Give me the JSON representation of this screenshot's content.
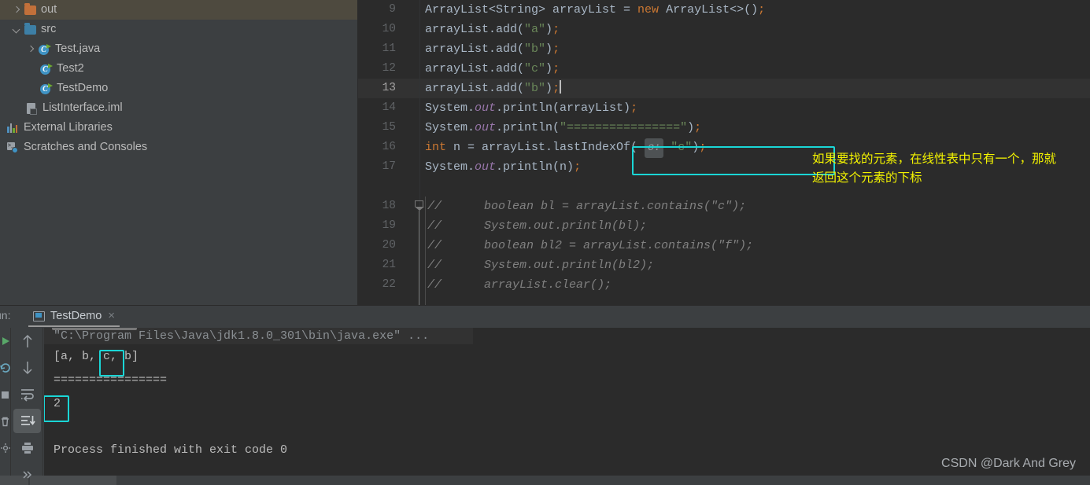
{
  "sidebar": {
    "items": [
      {
        "label": "out",
        "icon": "folder-orange-icon",
        "arrow": "chevron-right-icon",
        "indent": 14,
        "selected": true
      },
      {
        "label": "src",
        "icon": "folder-blue-icon",
        "arrow": "chevron-down-icon",
        "indent": 14,
        "selected": false
      },
      {
        "label": "Test.java",
        "icon": "java-class-icon",
        "arrow": "chevron-right-icon",
        "indent": 32,
        "selected": false
      },
      {
        "label": "Test2",
        "icon": "java-class-icon",
        "arrow": "none",
        "indent": 50,
        "selected": false
      },
      {
        "label": "TestDemo",
        "icon": "java-class-icon",
        "arrow": "none",
        "indent": 50,
        "selected": false
      },
      {
        "label": "ListInterface.iml",
        "icon": "iml-file-icon",
        "arrow": "none",
        "indent": 32,
        "selected": false
      },
      {
        "label": "External Libraries",
        "icon": "libraries-icon",
        "arrow": "none",
        "indent": 8,
        "selected": false
      },
      {
        "label": "Scratches and Consoles",
        "icon": "scratches-icon",
        "arrow": "none",
        "indent": 8,
        "selected": false
      }
    ]
  },
  "editor": {
    "lines": [
      {
        "num": "9",
        "current": false,
        "comment": ""
      },
      {
        "num": "10",
        "current": false,
        "comment": ""
      },
      {
        "num": "11",
        "current": false,
        "comment": ""
      },
      {
        "num": "12",
        "current": false,
        "comment": ""
      },
      {
        "num": "13",
        "current": true,
        "comment": ""
      },
      {
        "num": "14",
        "current": false,
        "comment": ""
      },
      {
        "num": "15",
        "current": false,
        "comment": ""
      },
      {
        "num": "16",
        "current": false,
        "comment": ""
      },
      {
        "num": "17",
        "current": false,
        "comment": ""
      },
      {
        "num": "18",
        "current": false,
        "comment": "//"
      },
      {
        "num": "19",
        "current": false,
        "comment": "//"
      },
      {
        "num": "20",
        "current": false,
        "comment": "//"
      },
      {
        "num": "21",
        "current": false,
        "comment": "//"
      },
      {
        "num": "22",
        "current": false,
        "comment": "//"
      }
    ],
    "code": {
      "l9_a": "ArrayList<String> arrayList = ",
      "l9_new": "new",
      "l9_b": " ArrayList<>()",
      "l9_semi": ";",
      "l10_a": "arrayList.add(",
      "l10_s": "\"a\"",
      "l10_b": ")",
      "l10_semi": ";",
      "l11_a": "arrayList.add(",
      "l11_s": "\"b\"",
      "l11_b": ")",
      "l11_semi": ";",
      "l12_a": "arrayList.add(",
      "l12_s": "\"c\"",
      "l12_b": ")",
      "l12_semi": ";",
      "l13_a": "arrayList.add(",
      "l13_s": "\"b\"",
      "l13_b": ")",
      "l13_semi": ";",
      "l14_sys": "System.",
      "l14_out": "out",
      "l14_rest": ".println(arrayList)",
      "l14_semi": ";",
      "l15_sys": "System.",
      "l15_out": "out",
      "l15_a": ".println(",
      "l15_s": "\"================\"",
      "l15_b": ")",
      "l15_semi": ";",
      "l16_int": "int",
      "l16_a": " n = arrayList.lastIndexOf( ",
      "l16_hint": "o:",
      "l16_s": "\"c\"",
      "l16_b": ")",
      "l16_semi": ";",
      "l17_sys": "System.",
      "l17_out": "out",
      "l17_rest": ".println(n)",
      "l17_semi": ";",
      "l18": "boolean bl = arrayList.contains(\"c\");",
      "l19": "System.out.println(bl);",
      "l20": "boolean bl2 = arrayList.contains(\"f\");",
      "l21": "System.out.println(bl2);",
      "l22": "arrayList.clear();"
    },
    "annotation_line1": "如果要找的元素，在线性表中只有一个，那就",
    "annotation_line2": "返回这个元素的下标"
  },
  "run_panel": {
    "label": "un:",
    "tab_name": "TestDemo",
    "tab_close": "×",
    "toolbar": [
      {
        "name": "scroll-up-button",
        "icon": "arrow-up-icon",
        "active": false
      },
      {
        "name": "scroll-down-button",
        "icon": "arrow-down-icon",
        "active": false
      },
      {
        "name": "soft-wrap-button",
        "icon": "soft-wrap-icon",
        "active": false
      },
      {
        "name": "scroll-to-end-button",
        "icon": "scroll-to-end-icon",
        "active": true
      },
      {
        "name": "print-button",
        "icon": "printer-icon",
        "active": false
      },
      {
        "name": "more-options-button",
        "icon": "chevron-double-right-icon",
        "active": false
      }
    ],
    "console": {
      "command": "\"C:\\Program Files\\Java\\jdk1.8.0_301\\bin\\java.exe\" ...",
      "line_list": "[a, b, c, b]",
      "line_sep": "================",
      "line_result": "2",
      "line_finished": "Process finished with exit code 0"
    }
  },
  "watermark": "CSDN @Dark And Grey",
  "colors": {
    "accent_cyan": "#1ad6d6",
    "annotation_yellow": "#f3f300",
    "editor_bg": "#2b2b2b",
    "panel_bg": "#3c3f41",
    "selection_olive": "#4e4a3f"
  }
}
